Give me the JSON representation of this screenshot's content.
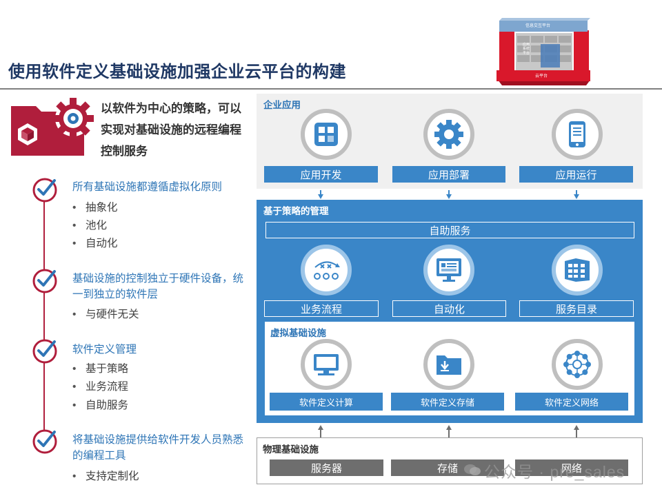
{
  "title": "使用软件定义基础设施加强企业云平台的构建",
  "logo": {
    "top_label": "信息交互平台",
    "left_label": "应用系统平台",
    "bottom_label": "云平台"
  },
  "lead": "以软件为中心的策略，可以实现对基础设施的远程编程控制服务",
  "principles": [
    {
      "heading": "所有基础设施都遵循虚拟化原则",
      "bullets": [
        "抽象化",
        "池化",
        "自动化"
      ]
    },
    {
      "heading": "基础设施的控制独立于硬件设备，统一到独立的软件层",
      "bullets": [
        "与硬件无关"
      ]
    },
    {
      "heading": "软件定义管理",
      "bullets": [
        "基于策略",
        "业务流程",
        "自助服务"
      ]
    },
    {
      "heading": "将基础设施提供给软件开发人员熟悉的编程工具",
      "bullets": [
        "支持定制化"
      ]
    }
  ],
  "enterprise_apps": {
    "label": "企业应用",
    "items": [
      {
        "label": "应用开发",
        "icon": "app-grid-icon"
      },
      {
        "label": "应用部署",
        "icon": "gear-icon"
      },
      {
        "label": "应用运行",
        "icon": "mobile-icon"
      }
    ]
  },
  "policy_mgmt": {
    "label": "基于策略的管理",
    "self_service": "自助服务",
    "items": [
      {
        "label": "业务流程",
        "icon": "workflow-icon"
      },
      {
        "label": "自动化",
        "icon": "monitor-chart-icon"
      },
      {
        "label": "服务目录",
        "icon": "catalog-icon"
      }
    ]
  },
  "virtual_infra": {
    "label": "虚拟基础设施",
    "items": [
      {
        "label": "软件定义计算",
        "icon": "desktop-icon"
      },
      {
        "label": "软件定义存储",
        "icon": "folder-download-icon"
      },
      {
        "label": "软件定义网络",
        "icon": "network-icon"
      }
    ]
  },
  "physical_infra": {
    "label": "物理基础设施",
    "items": [
      "服务器",
      "存储",
      "网络"
    ]
  },
  "watermark": "公众号 · pre_sales",
  "colors": {
    "title": "#1f3864",
    "accent_red": "#b01e3c",
    "blue": "#3a86c8",
    "heading_blue": "#2e75b6",
    "grey_bar": "#6e6e6e"
  }
}
